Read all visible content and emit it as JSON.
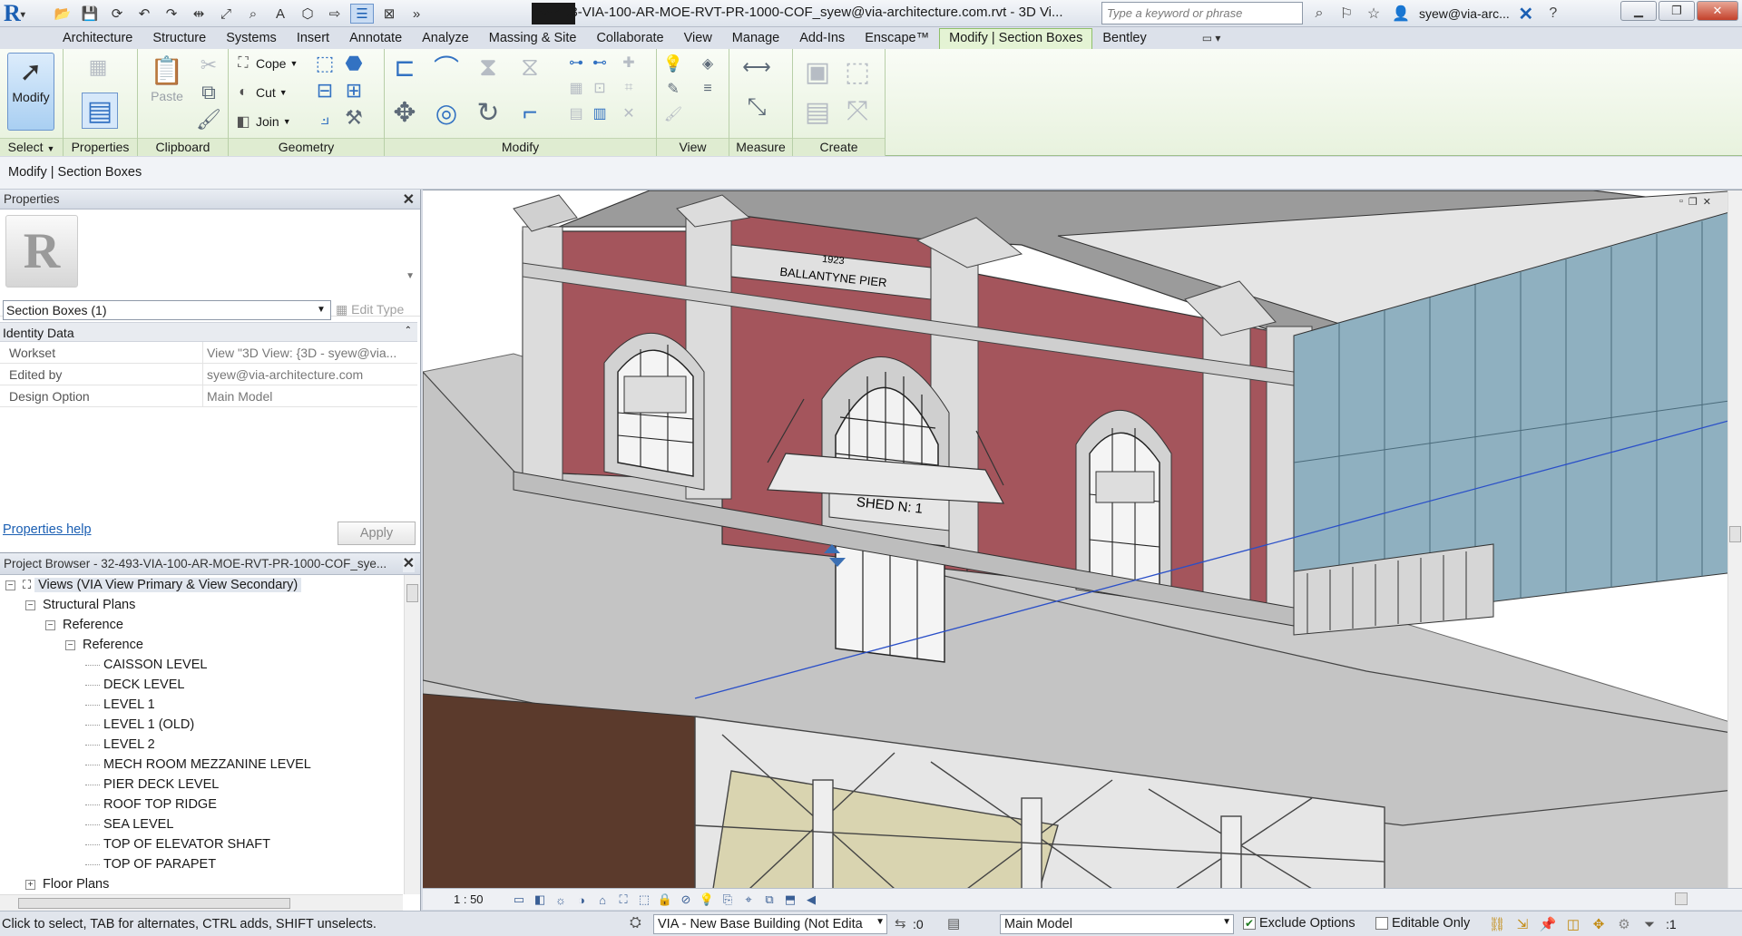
{
  "app": {
    "logo": "R",
    "logo_caret": "▾"
  },
  "quick_access": [
    {
      "name": "open-icon",
      "glyph": "📂"
    },
    {
      "name": "save-icon",
      "glyph": "💾"
    },
    {
      "name": "sync-central-icon",
      "glyph": "⟳"
    },
    {
      "name": "undo-icon",
      "glyph": "↶"
    },
    {
      "name": "redo-icon",
      "glyph": "↷"
    },
    {
      "name": "measure-icon",
      "glyph": "⇹"
    },
    {
      "name": "dimension-icon",
      "glyph": "⤢"
    },
    {
      "name": "tag-icon",
      "glyph": "⌕"
    },
    {
      "name": "text-icon",
      "glyph": "A"
    },
    {
      "name": "3d-view-icon",
      "glyph": "⬡"
    },
    {
      "name": "section-icon",
      "glyph": "⇨"
    },
    {
      "name": "thin-lines-icon",
      "glyph": "☰"
    },
    {
      "name": "close-hidden-icon",
      "glyph": "⊠"
    },
    {
      "name": "more-icon",
      "glyph": "»"
    }
  ],
  "title": "32-493-VIA-100-AR-MOE-RVT-PR-1000-COF_syew@via-architecture.com.rvt - 3D Vi...",
  "search": {
    "placeholder": "Type a keyword or phrase"
  },
  "user": {
    "name": "syew@via-arc..."
  },
  "tabs": [
    "Architecture",
    "Structure",
    "Systems",
    "Insert",
    "Annotate",
    "Analyze",
    "Massing & Site",
    "Collaborate",
    "View",
    "Manage",
    "Add-Ins",
    "Enscape™",
    "Modify | Section Boxes",
    "Bentley"
  ],
  "active_tab": "Modify | Section Boxes",
  "ribbon": {
    "modify_label": "Modify",
    "paste_label": "Paste",
    "cope_label": "Cope",
    "cut_label": "Cut",
    "join_label": "Join",
    "panels": {
      "select": "Select",
      "properties": "Properties",
      "clipboard": "Clipboard",
      "geometry": "Geometry",
      "modify": "Modify",
      "view": "View",
      "measure": "Measure",
      "create": "Create"
    }
  },
  "context_label": "Modify | Section Boxes",
  "properties": {
    "title": "Properties",
    "type_selector": "Section Boxes (1)",
    "edit_type": "Edit Type",
    "group": "Identity Data",
    "rows": [
      {
        "key": "Workset",
        "value": "View \"3D View: {3D - syew@via..."
      },
      {
        "key": "Edited by",
        "value": "syew@via-architecture.com"
      },
      {
        "key": "Design Option",
        "value": "Main Model"
      }
    ],
    "help": "Properties help",
    "apply": "Apply"
  },
  "browser": {
    "title": "Project Browser - 32-493-VIA-100-AR-MOE-RVT-PR-1000-COF_sye...",
    "nodes": [
      {
        "label": "Views (VIA View Primary & View Secondary)",
        "level": 0,
        "expander": "−",
        "selected": true
      },
      {
        "label": "Structural Plans",
        "level": 1,
        "expander": "−"
      },
      {
        "label": "Reference",
        "level": 2,
        "expander": "−"
      },
      {
        "label": "Reference",
        "level": 3,
        "expander": "−"
      },
      {
        "label": "CAISSON LEVEL",
        "level": 4
      },
      {
        "label": "DECK LEVEL",
        "level": 4
      },
      {
        "label": "LEVEL 1",
        "level": 4
      },
      {
        "label": "LEVEL 1 (OLD)",
        "level": 4
      },
      {
        "label": "LEVEL 2",
        "level": 4
      },
      {
        "label": "MECH ROOM MEZZANINE LEVEL",
        "level": 4
      },
      {
        "label": "PIER DECK LEVEL",
        "level": 4
      },
      {
        "label": "ROOF TOP RIDGE",
        "level": 4
      },
      {
        "label": "SEA LEVEL",
        "level": 4
      },
      {
        "label": "TOP OF ELEVATOR SHAFT",
        "level": 4
      },
      {
        "label": "TOP OF PARAPET",
        "level": 4
      },
      {
        "label": "Floor Plans",
        "level": 1,
        "expander": "+"
      }
    ]
  },
  "viewport": {
    "signage": {
      "year": "1923",
      "name": "BALLANTYNE PIER",
      "shed": "SHED N: 1"
    },
    "colors": {
      "brick": "#a4555c",
      "stone": "#d8d8d8",
      "roof": "#9b9b9b",
      "deck": "#c4c4c4",
      "water": "#5b3a2c",
      "glass": "#8fb0c0",
      "section_line": "#2a4fc8"
    }
  },
  "view_controls": {
    "scale": "1 : 50"
  },
  "status": {
    "message": "Click to select, TAB for alternates, CTRL adds, SHIFT unselects.",
    "workset": "VIA - New Base Building (Not Edita",
    "sync_count": ":0",
    "design_option": "Main Model",
    "exclude_options": "Exclude Options",
    "exclude_checked": true,
    "editable_only": "Editable Only",
    "editable_checked": false,
    "filter_count": ":1"
  }
}
